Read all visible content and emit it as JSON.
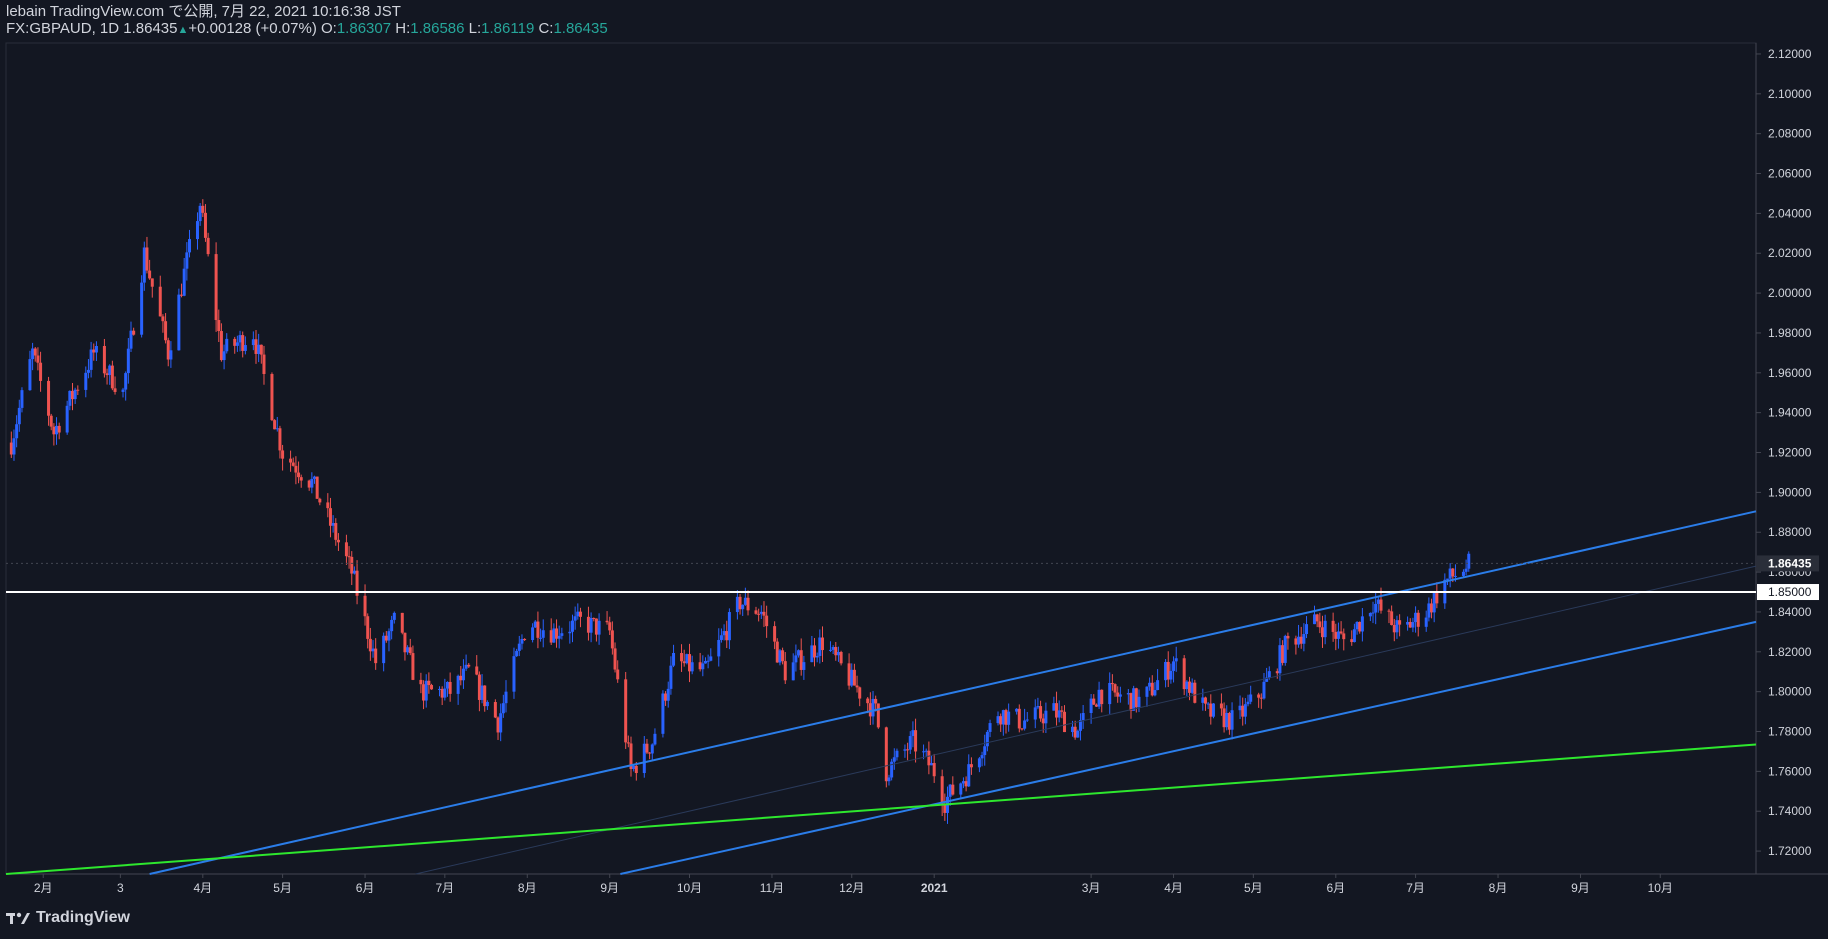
{
  "header": {
    "published": "lebain TradingView.com で公開, 7月 22, 2021 10:16:38 JST",
    "symbol": "FX:GBPAUD, 1D",
    "last": "1.86435",
    "change_arrow": "▲",
    "change": "+0.00128 (+0.07%)",
    "o_label": "O:",
    "o_val": "1.86307",
    "h_label": "H:",
    "h_val": "1.86586",
    "l_label": "L:",
    "l_val": "1.86119",
    "c_label": "C:",
    "c_val": "1.86435"
  },
  "footer": {
    "logo_icon": "tv-logo-icon",
    "brand": "TradingView"
  },
  "colors": {
    "background": "#131722",
    "up": "#2962ff",
    "down": "#ef5350",
    "channel": "#2b7de9",
    "support": "#2ee82e",
    "level": "#ffffff",
    "axis_text": "#d1d4dc"
  },
  "chart_data": {
    "type": "candlestick",
    "symbol": "FX:GBPAUD",
    "timeframe": "1D",
    "x_ticks": [
      {
        "label": "2月",
        "date": "2020-02-01"
      },
      {
        "label": "3",
        "date": "2020-03-01"
      },
      {
        "label": "4月",
        "date": "2020-04-01"
      },
      {
        "label": "5月",
        "date": "2020-05-01"
      },
      {
        "label": "6月",
        "date": "2020-06-01"
      },
      {
        "label": "7月",
        "date": "2020-07-01"
      },
      {
        "label": "8月",
        "date": "2020-08-01"
      },
      {
        "label": "9月",
        "date": "2020-09-01"
      },
      {
        "label": "10月",
        "date": "2020-10-01"
      },
      {
        "label": "11月",
        "date": "2020-11-01"
      },
      {
        "label": "12月",
        "date": "2020-12-01"
      },
      {
        "label": "2021",
        "date": "2021-01-01"
      },
      {
        "label": "3月",
        "date": "2021-03-01"
      },
      {
        "label": "4月",
        "date": "2021-04-01"
      },
      {
        "label": "5月",
        "date": "2021-05-01"
      },
      {
        "label": "6月",
        "date": "2021-06-01"
      },
      {
        "label": "7月",
        "date": "2021-07-01"
      },
      {
        "label": "8月",
        "date": "2021-08-01"
      },
      {
        "label": "9月",
        "date": "2021-09-01"
      },
      {
        "label": "10月",
        "date": "2021-10-01"
      }
    ],
    "y_ticks": [
      "2.12000",
      "2.10000",
      "2.08000",
      "2.06000",
      "2.04000",
      "2.02000",
      "2.00000",
      "1.98000",
      "1.96000",
      "1.94000",
      "1.92000",
      "1.90000",
      "1.88000",
      "1.86000",
      "1.84000",
      "1.82000",
      "1.80000",
      "1.78000",
      "1.76000",
      "1.74000",
      "1.72000"
    ],
    "ylim": [
      1.7085,
      2.1255
    ],
    "xlim": [
      "2020-01-18",
      "2021-11-06"
    ],
    "price_labels": [
      {
        "value": 1.86435,
        "text": "1.86435"
      },
      {
        "value": 1.85,
        "text": "1.85000"
      }
    ],
    "anchors": [
      {
        "date": "2020-01-20",
        "close": 1.925
      },
      {
        "date": "2020-01-28",
        "close": 1.97
      },
      {
        "date": "2020-02-05",
        "close": 1.93
      },
      {
        "date": "2020-02-20",
        "close": 1.97
      },
      {
        "date": "2020-03-02",
        "close": 1.95
      },
      {
        "date": "2020-03-10",
        "close": 2.02
      },
      {
        "date": "2020-03-19",
        "close": 1.97
      },
      {
        "date": "2020-03-25",
        "close": 2.01
      },
      {
        "date": "2020-03-31",
        "close": 2.045
      },
      {
        "date": "2020-04-08",
        "close": 1.97
      },
      {
        "date": "2020-04-20",
        "close": 1.98
      },
      {
        "date": "2020-05-01",
        "close": 1.92
      },
      {
        "date": "2020-05-12",
        "close": 1.905
      },
      {
        "date": "2020-05-27",
        "close": 1.86
      },
      {
        "date": "2020-06-05",
        "close": 1.815
      },
      {
        "date": "2020-06-12",
        "close": 1.835
      },
      {
        "date": "2020-06-22",
        "close": 1.8
      },
      {
        "date": "2020-07-03",
        "close": 1.8
      },
      {
        "date": "2020-07-10",
        "close": 1.81
      },
      {
        "date": "2020-07-21",
        "close": 1.785
      },
      {
        "date": "2020-08-01",
        "close": 1.835
      },
      {
        "date": "2020-08-11",
        "close": 1.83
      },
      {
        "date": "2020-08-21",
        "close": 1.835
      },
      {
        "date": "2020-09-01",
        "close": 1.83
      },
      {
        "date": "2020-09-09",
        "close": 1.76
      },
      {
        "date": "2020-09-17",
        "close": 1.775
      },
      {
        "date": "2020-09-25",
        "close": 1.815
      },
      {
        "date": "2020-10-07",
        "close": 1.81
      },
      {
        "date": "2020-10-20",
        "close": 1.845
      },
      {
        "date": "2020-10-28",
        "close": 1.84
      },
      {
        "date": "2020-11-06",
        "close": 1.81
      },
      {
        "date": "2020-11-20",
        "close": 1.825
      },
      {
        "date": "2020-12-01",
        "close": 1.805
      },
      {
        "date": "2020-12-10",
        "close": 1.79
      },
      {
        "date": "2020-12-14",
        "close": 1.76
      },
      {
        "date": "2020-12-24",
        "close": 1.775
      },
      {
        "date": "2021-01-01",
        "close": 1.76
      },
      {
        "date": "2021-01-05",
        "close": 1.745
      },
      {
        "date": "2021-01-14",
        "close": 1.76
      },
      {
        "date": "2021-01-25",
        "close": 1.79
      },
      {
        "date": "2021-02-03",
        "close": 1.785
      },
      {
        "date": "2021-02-15",
        "close": 1.79
      },
      {
        "date": "2021-02-24",
        "close": 1.78
      },
      {
        "date": "2021-03-04",
        "close": 1.8
      },
      {
        "date": "2021-03-20",
        "close": 1.795
      },
      {
        "date": "2021-04-01",
        "close": 1.815
      },
      {
        "date": "2021-04-13",
        "close": 1.79
      },
      {
        "date": "2021-04-24",
        "close": 1.785
      },
      {
        "date": "2021-05-04",
        "close": 1.8
      },
      {
        "date": "2021-05-14",
        "close": 1.825
      },
      {
        "date": "2021-05-25",
        "close": 1.835
      },
      {
        "date": "2021-06-05",
        "close": 1.825
      },
      {
        "date": "2021-06-15",
        "close": 1.845
      },
      {
        "date": "2021-06-25",
        "close": 1.83
      },
      {
        "date": "2021-07-05",
        "close": 1.84
      },
      {
        "date": "2021-07-12",
        "close": 1.855
      },
      {
        "date": "2021-07-22",
        "close": 1.86435
      }
    ],
    "trendlines": [
      {
        "name": "channel-upper",
        "color": "#2b7de9",
        "from": {
          "date": "2020-03-12",
          "value": 1.7085
        },
        "to": {
          "date": "2021-11-06",
          "value": 1.8905
        }
      },
      {
        "name": "channel-lower",
        "color": "#2b7de9",
        "from": {
          "date": "2020-09-05",
          "value": 1.7085
        },
        "to": {
          "date": "2021-11-06",
          "value": 1.835
        }
      },
      {
        "name": "channel-mid",
        "color": "#2a3a5a",
        "from": {
          "date": "2020-06-20",
          "value": 1.7085
        },
        "to": {
          "date": "2021-11-06",
          "value": 1.863
        }
      },
      {
        "name": "support",
        "color": "#2ee82e",
        "from": {
          "date": "2020-01-18",
          "value": 1.7085
        },
        "to": {
          "date": "2021-11-06",
          "value": 1.7735
        }
      }
    ],
    "hlines": [
      {
        "name": "level-1.85",
        "color": "#ffffff",
        "value": 1.85
      },
      {
        "name": "last-price",
        "color": "#434651",
        "value": 1.86435
      }
    ]
  }
}
